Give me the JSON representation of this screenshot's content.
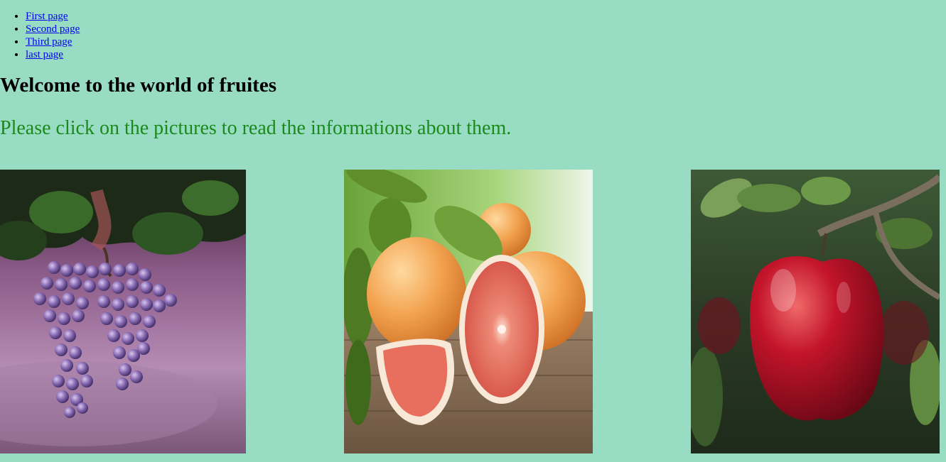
{
  "nav": {
    "items": [
      {
        "label": "First page"
      },
      {
        "label": "Second page"
      },
      {
        "label": "Third page"
      },
      {
        "label": "last page"
      }
    ]
  },
  "heading": "Welcome to the world of fruites",
  "intro": "Please click on the pictures to read the informations about them.",
  "colors": {
    "background": "#99dcc4",
    "link": "#0000ee",
    "intro_text": "#1a8a1a"
  },
  "gallery": {
    "images": [
      {
        "subject": "grapes"
      },
      {
        "subject": "grapefruit"
      },
      {
        "subject": "apple"
      }
    ]
  }
}
